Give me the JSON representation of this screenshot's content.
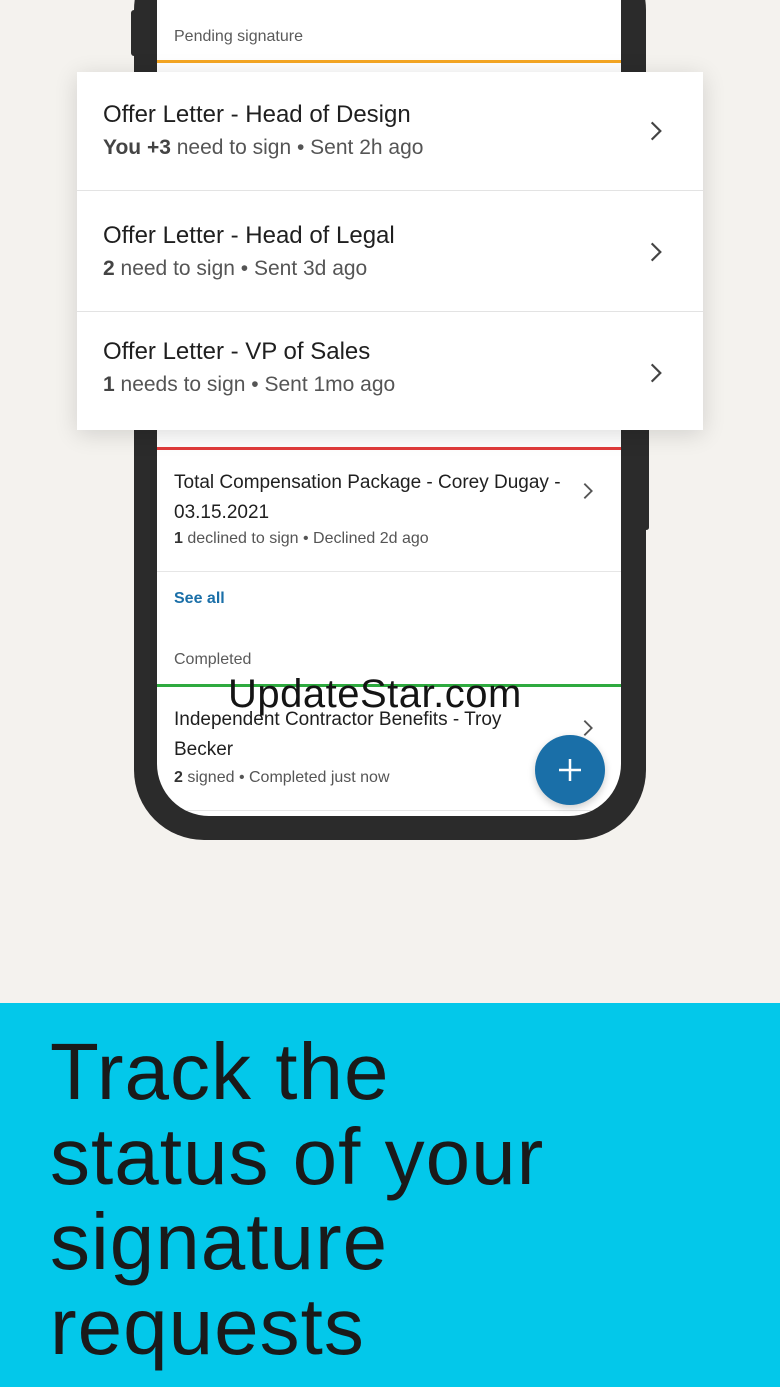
{
  "phone_screen": {
    "pending_label": "Pending signature",
    "declined_row": {
      "title": "Total Compensation Package - Corey Dugay - 03.15.2021",
      "count": "1",
      "status": " declined to sign • Declined 2d ago"
    },
    "see_all": "See all",
    "completed_label": "Completed",
    "completed_row": {
      "title": "Independent Contractor Benefits - Troy Becker",
      "count": "2",
      "status": " signed • Completed just now"
    },
    "fab_icon": "plus-icon"
  },
  "card": {
    "rows": [
      {
        "title": "Offer Letter - Head of Design",
        "count": "You +3",
        "status": " need to sign • Sent 2h ago"
      },
      {
        "title": "Offer Letter - Head of Legal",
        "count": "2",
        "status": " need to sign • Sent 3d ago"
      },
      {
        "title": "Offer Letter - VP of Sales",
        "count": "1",
        "status": " needs to sign • Sent 1mo ago"
      }
    ]
  },
  "watermark": "UpdateStar.com",
  "banner": {
    "lines": [
      "Track the",
      "status of your",
      "signature",
      "requests"
    ]
  },
  "colors": {
    "pending": "#f5a623",
    "declined": "#e03b3b",
    "completed": "#2eaa3f",
    "accent": "#1a6fa8",
    "banner": "#03c8ea"
  }
}
